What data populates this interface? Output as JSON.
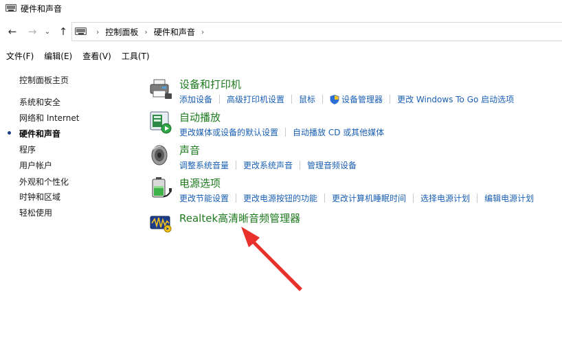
{
  "window": {
    "title": "硬件和声音"
  },
  "nav": {
    "back_icon": "back-arrow-icon",
    "forward_icon": "forward-arrow-icon",
    "recent_icon": "chevron-down-icon",
    "up_icon": "up-arrow-icon"
  },
  "address": {
    "crumbs": [
      "控制面板",
      "硬件和声音"
    ]
  },
  "menu": {
    "file": "文件(F)",
    "edit": "编辑(E)",
    "view": "查看(V)",
    "tools": "工具(T)"
  },
  "sidebar": {
    "home": "控制面板主页",
    "items": [
      {
        "label": "系统和安全"
      },
      {
        "label": "网络和 Internet"
      },
      {
        "label": "硬件和声音"
      },
      {
        "label": "程序"
      },
      {
        "label": "用户帐户"
      },
      {
        "label": "外观和个性化"
      },
      {
        "label": "时钟和区域"
      },
      {
        "label": "轻松使用"
      }
    ],
    "current_index": 2
  },
  "categories": [
    {
      "title": "设备和打印机",
      "icon": "printer-icon",
      "links": [
        "添加设备",
        "高级打印机设置",
        "鼠标",
        "设备管理器",
        "更改 Windows To Go 启动选项"
      ]
    },
    {
      "title": "自动播放",
      "icon": "autoplay-icon",
      "links": [
        "更改媒体或设备的默认设置",
        "自动播放 CD 或其他媒体"
      ]
    },
    {
      "title": "声音",
      "icon": "speaker-icon",
      "links": [
        "调整系统音量",
        "更改系统声音",
        "管理音频设备"
      ]
    },
    {
      "title": "电源选项",
      "icon": "battery-icon",
      "links": [
        "更改节能设置",
        "更改电源按钮的功能",
        "更改计算机睡眠时间",
        "选择电源计划",
        "编辑电源计划"
      ]
    },
    {
      "title": "Realtek高清晰音频管理器",
      "icon": "realtek-audio-icon",
      "links": []
    }
  ],
  "colors": {
    "category_title": "#1e7a1e",
    "link": "#1a5fb4",
    "annotation_arrow": "#e8312a"
  }
}
